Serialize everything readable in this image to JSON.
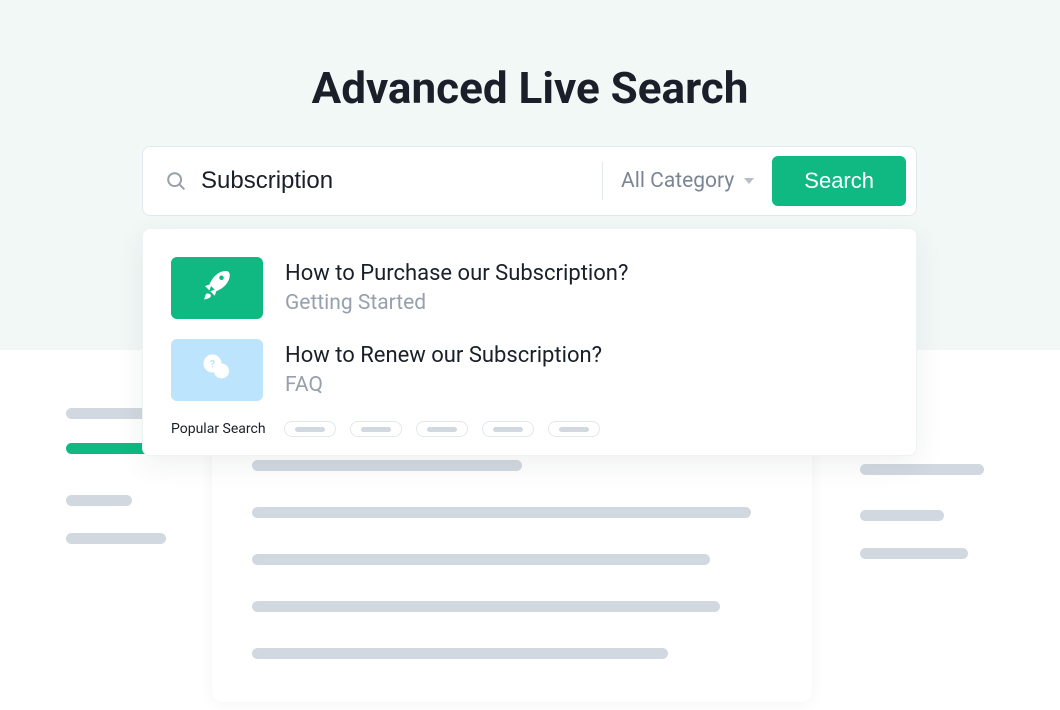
{
  "header": {
    "title": "Advanced Live Search"
  },
  "search": {
    "value": "Subscription",
    "category_selected": "All Category",
    "button_label": "Search",
    "popular_label": "Popular Search"
  },
  "results": [
    {
      "title": "How to Purchase our Subscription?",
      "category": "Getting Started",
      "icon": "rocket",
      "bg": "#10b981"
    },
    {
      "title": "How to Renew our Subscription?",
      "category": "FAQ",
      "icon": "chat",
      "bg": "#bde4fd"
    }
  ],
  "colors": {
    "accent": "#10b981",
    "muted": "#d2d8df"
  }
}
